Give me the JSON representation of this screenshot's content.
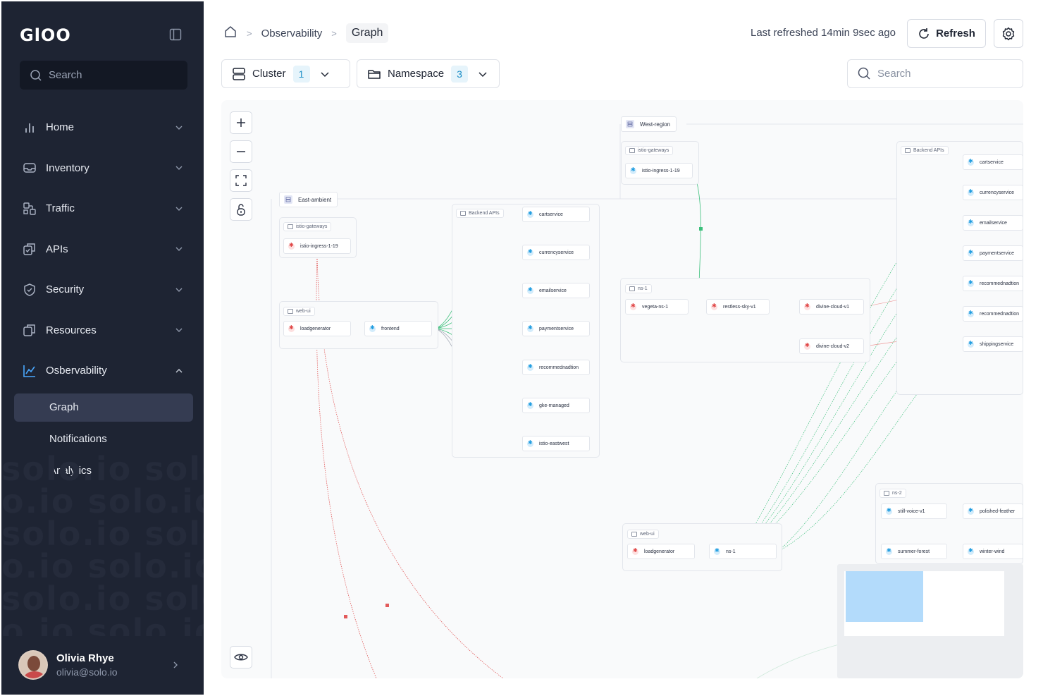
{
  "brand": {
    "logo_text": "GlOO"
  },
  "sidebar": {
    "search_placeholder": "Search",
    "items": [
      {
        "label": "Home",
        "icon": "bar-chart-icon"
      },
      {
        "label": "Inventory",
        "icon": "inbox-icon"
      },
      {
        "label": "Traffic",
        "icon": "traffic-icon"
      },
      {
        "label": "APIs",
        "icon": "api-icon"
      },
      {
        "label": "Security",
        "icon": "shield-icon"
      },
      {
        "label": "Resources",
        "icon": "copy-icon"
      },
      {
        "label": "Osbervability",
        "icon": "line-chart-icon"
      }
    ],
    "sub_items": [
      {
        "label": "Graph",
        "active": true
      },
      {
        "label": "Notifications",
        "active": false
      },
      {
        "label": "Analytics",
        "active": false
      }
    ],
    "user": {
      "name": "Olivia Rhye",
      "email": "olivia@solo.io"
    }
  },
  "header": {
    "breadcrumb": [
      "Observability",
      "Graph"
    ],
    "last_refreshed": "Last refreshed 14min 9sec ago",
    "refresh_label": "Refresh"
  },
  "filters": {
    "cluster": {
      "label": "Cluster",
      "count": "1"
    },
    "namespace": {
      "label": "Namespace",
      "count": "3"
    },
    "search_placeholder": "Search"
  },
  "graph": {
    "regions": {
      "east": "East-ambient",
      "west": "West-region"
    },
    "groups": {
      "istio_gw_east": "istio-gateways",
      "web_ui_east": "web-ui",
      "backend_east": "Backend APIs",
      "istio_gw_west": "istio-gateways",
      "backend_west": "Backend APIs",
      "ns1": "ns-1",
      "web_ui_west": "web-ui",
      "ns2": "ns-2"
    },
    "nodes": {
      "ingress_east": "istio-ingress-1-19",
      "loadgen_east": "loadgenerator",
      "frontend": "frontend",
      "e_cart": "cartservice",
      "e_currency": "currencyservice",
      "e_email": "emailservice",
      "e_payment": "paymentservice",
      "e_recommend": "recommednadtion",
      "e_gke": "gke-managed",
      "e_eastwest": "istio-eastwest",
      "ingress_west": "istio-ingress-1-19",
      "vegeta": "vegeta-ns-1",
      "restless": "restless-sky-v1",
      "divine1": "divine-cloud-v1",
      "divine2": "divine-cloud-v2",
      "w_cart": "cartservice",
      "w_currency": "currencyservice",
      "w_email": "emailservice",
      "w_payment": "paymentservice",
      "w_recommend1": "recommednadtion",
      "w_recommend2": "recommednadtion",
      "w_shipping": "shippingservice",
      "loadgen_west": "loadgenerator",
      "ns1_node": "ns-1",
      "still_voice": "still-voice-v1",
      "polished": "polished-feather",
      "summer": "summer-forest",
      "winter": "winter-wind"
    }
  },
  "colors": {
    "sidebar_bg": "#1e2433",
    "accent": "#1c8ec6",
    "edge_green": "#3bbf7a",
    "edge_red": "#e25a5a"
  }
}
